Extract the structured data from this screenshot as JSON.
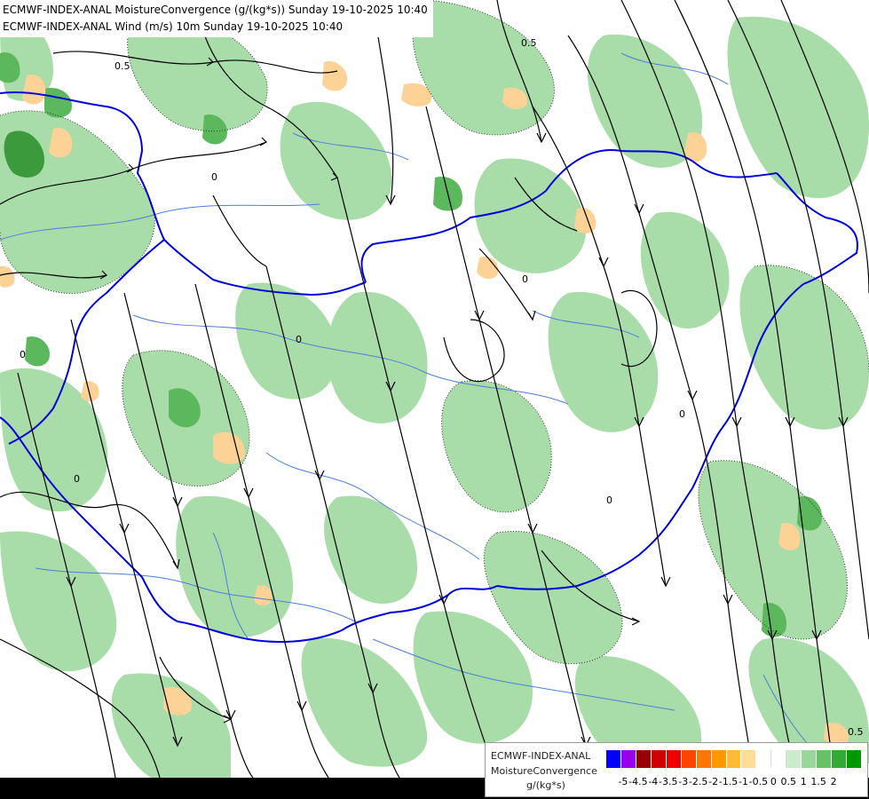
{
  "header": {
    "line1": "ECMWF-INDEX-ANAL MoistureConvergence (g/(kg*s)) Sunday 19-10-2025 10:40",
    "line2": "ECMWF-INDEX-ANAL Wind (m/s) 10m Sunday 19-10-2025 10:40"
  },
  "legend": {
    "model": "ECMWF-INDEX-ANAL",
    "parameter": "MoistureConvergence",
    "unit": "g/(kg*s)",
    "colors": [
      "#0000ff",
      "#9900ee",
      "#990000",
      "#cc0000",
      "#ee0000",
      "#ff4400",
      "#ff7700",
      "#ff9900",
      "#ffbb33",
      "#ffdd99",
      "#ffffff",
      "#ffffff",
      "#ccebcc",
      "#99d699",
      "#66c266",
      "#33aa33",
      "#009900"
    ],
    "ticks": [
      "-5",
      "-4.5",
      "-4",
      "-3.5",
      "-3",
      "-2.5",
      "-2",
      "-1.5",
      "-1",
      "-0.5",
      "0",
      "0.5",
      "1",
      "1.5",
      "2"
    ]
  },
  "map": {
    "contour_labels": [
      "0.5",
      "0.5",
      "0.5",
      "0",
      "0",
      "0",
      "0",
      "0",
      "0",
      "0"
    ]
  },
  "colors": {
    "convergence_green": "#a8dca8",
    "strong_green": "#3b9a3b",
    "divergence_orange": "#fcd296",
    "border_blue": "#0000dd",
    "river_blue": "#4f7fd8",
    "streamline": "#000000"
  }
}
